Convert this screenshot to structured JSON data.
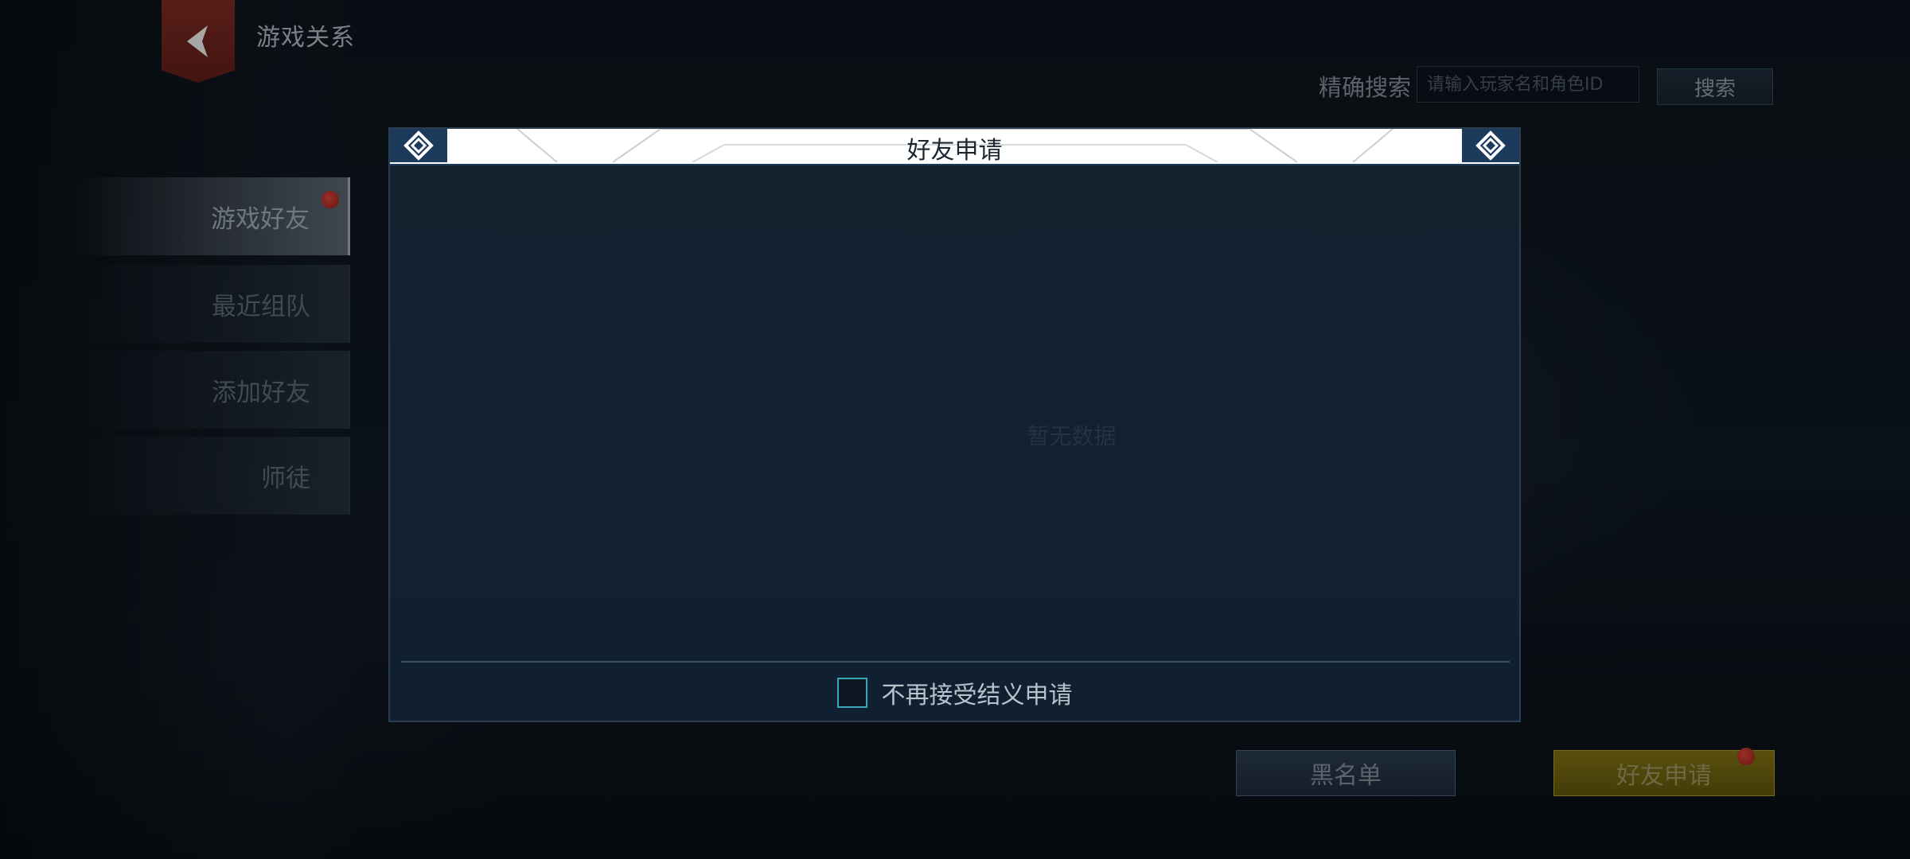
{
  "header": {
    "title": "游戏关系",
    "back_icon": "chevron-left-icon"
  },
  "search": {
    "label": "精确搜索",
    "placeholder": "请输入玩家名和角色ID",
    "button_label": "搜索"
  },
  "sidebar": {
    "items": [
      {
        "label": "游戏好友",
        "active": true,
        "badge": true
      },
      {
        "label": "最近组队",
        "active": false,
        "badge": false
      },
      {
        "label": "添加好友",
        "active": false,
        "badge": false
      },
      {
        "label": "师徒",
        "active": false,
        "badge": false
      }
    ]
  },
  "bottom_buttons": {
    "blacklist_label": "黑名单",
    "friend_request_label": "好友申请"
  },
  "modal": {
    "title": "好友申请",
    "empty_text": "暂无数据",
    "checkbox_label": "不再接受结义申请",
    "checkbox_checked": false
  },
  "colors": {
    "accent_red": "#8e1d18",
    "accent_gold": "#a8961e",
    "modal_bg": "#122030",
    "checkbox_border": "#3aa7b8"
  }
}
